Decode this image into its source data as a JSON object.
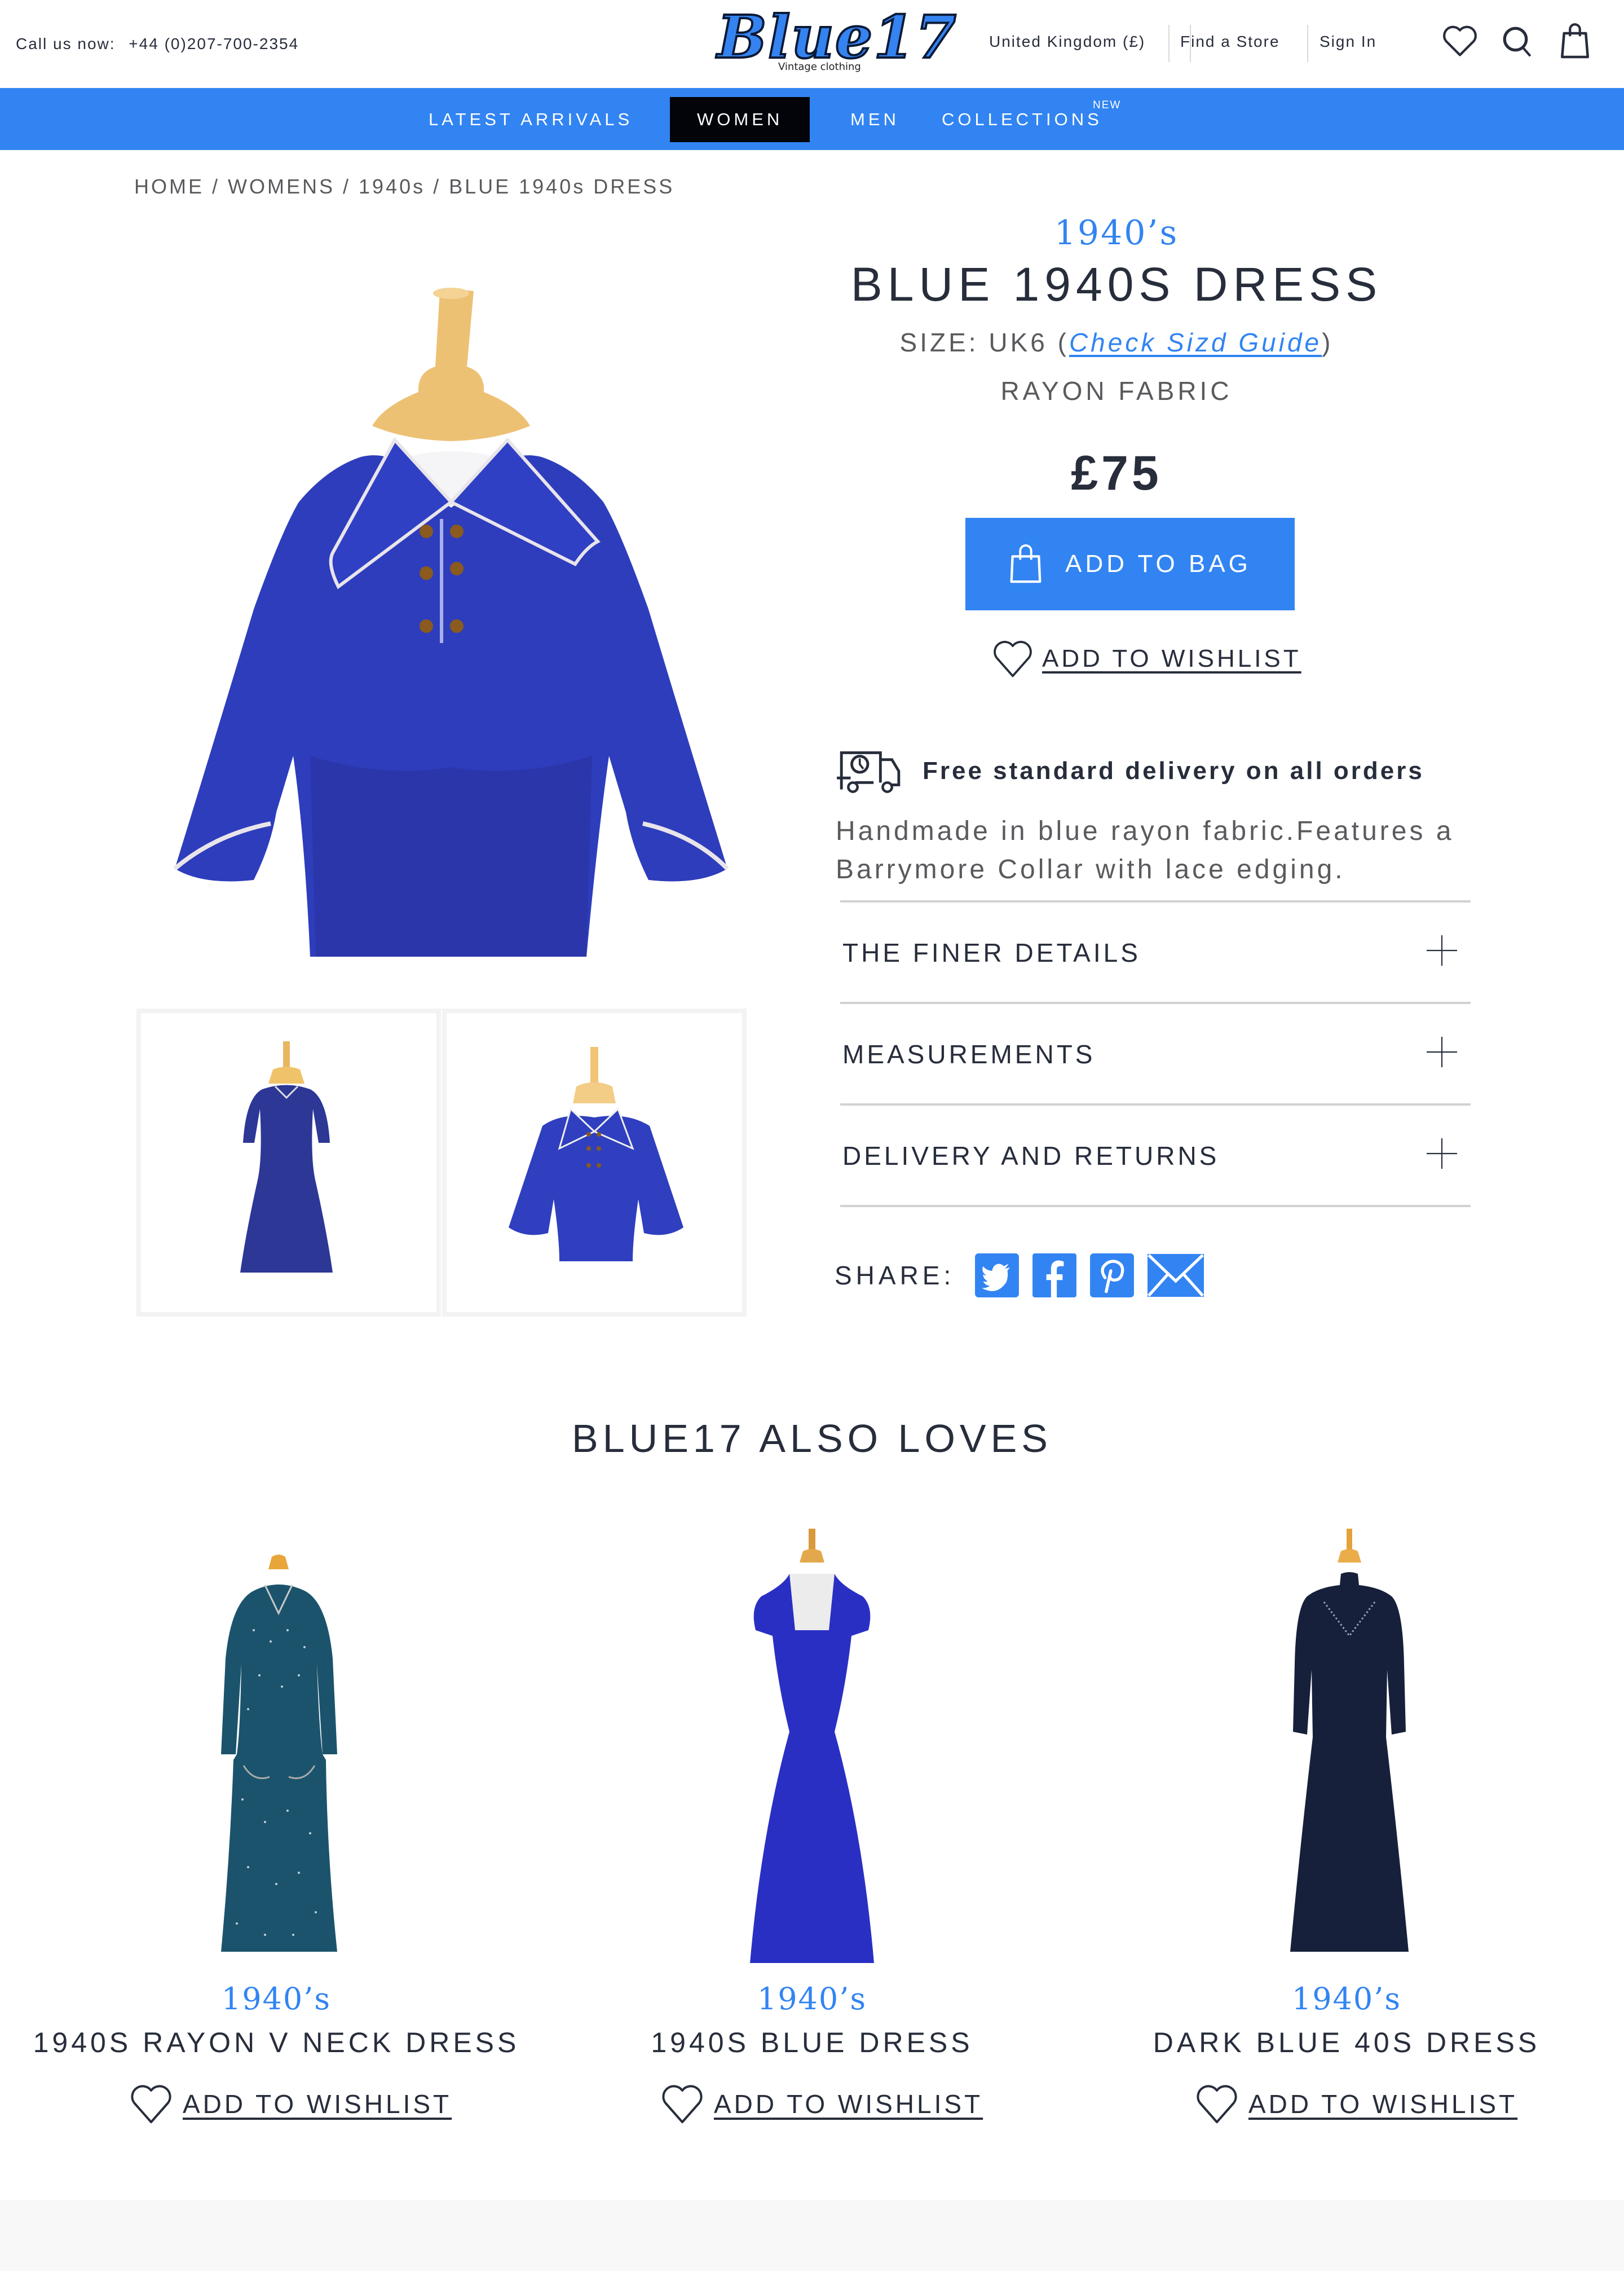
{
  "header": {
    "call_label": "Call us now:",
    "phone": "+44 (0)207-700-2354",
    "logo_text": "Blue17",
    "logo_tagline": "Vintage clothing",
    "region": "United Kingdom (£)",
    "find_store": "Find a Store",
    "sign_in": "Sign In",
    "icons": [
      "heart-icon",
      "search-icon",
      "shopping-bag-icon"
    ]
  },
  "nav": {
    "items": [
      {
        "label": "LATEST ARRIVALS",
        "active": false
      },
      {
        "label": "WOMEN",
        "active": true
      },
      {
        "label": "MEN",
        "active": false
      },
      {
        "label": "COLLECTIONS",
        "active": false,
        "badge": "NEW"
      }
    ]
  },
  "breadcrumb": "HOME / WOMENS / 1940s / BLUE 1940s DRESS",
  "product": {
    "era": "1940’s",
    "title": "BLUE 1940S DRESS",
    "size_label": "SIZE: UK6 (",
    "size_link": "Check Sizd Guide",
    "size_close": ")",
    "fabric": "RAYON FABRIC",
    "price": "£75",
    "add_to_bag": "ADD TO BAG",
    "add_to_wishlist": "ADD TO WISHLIST",
    "delivery": "Free standard delivery on all orders",
    "description": "Handmade in blue rayon fabric.Features a Barrymore Collar with lace edging.",
    "accordion": [
      {
        "label": "THE FINER DETAILS"
      },
      {
        "label": "MEASUREMENTS"
      },
      {
        "label": "DELIVERY AND RETURNS"
      }
    ],
    "share_label": "SHARE:",
    "share": [
      "twitter-icon",
      "facebook-icon",
      "pinterest-icon",
      "email-icon"
    ],
    "images": {
      "main": "blue dress bodice on mannequin",
      "thumbs": [
        "full-length blue dress",
        "blue dress bodice close-up"
      ]
    }
  },
  "colors": {
    "accent": "#3284f2",
    "text": "#272d3b",
    "muted": "#5a5a5e",
    "active_nav": "#02040a",
    "footer_bg": "#f8f8f8"
  },
  "also_loves": {
    "title": "BLUE17 ALSO LOVES",
    "items": [
      {
        "era": "1940’s",
        "name": "1940S RAYON V NECK DRESS",
        "wishlist": "ADD TO WISHLIST"
      },
      {
        "era": "1940’s",
        "name": "1940S BLUE DRESS",
        "wishlist": "ADD TO WISHLIST"
      },
      {
        "era": "1940’s",
        "name": "DARK BLUE 40S DRESS",
        "wishlist": "ADD TO WISHLIST"
      }
    ]
  }
}
